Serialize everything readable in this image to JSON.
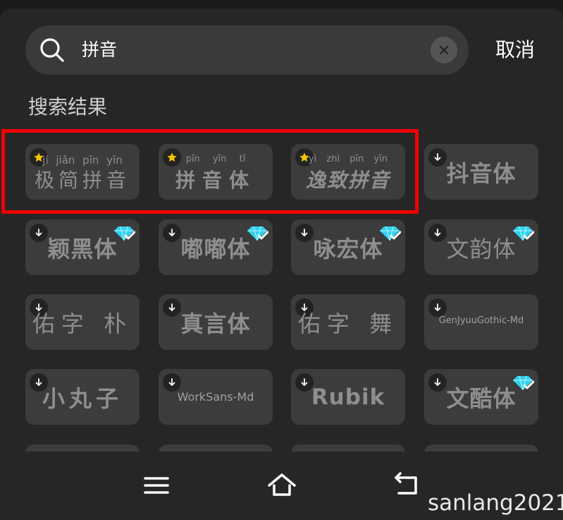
{
  "search": {
    "query": "拼音"
  },
  "header": {
    "cancel_label": "取消"
  },
  "section": {
    "title": "搜索结果"
  },
  "fonts": {
    "jijian": {
      "pinyin": "jí jiǎn pīn yīn",
      "hanzi": "极简拼音"
    },
    "pinyinti": {
      "pinyin": "pīn yīn tǐ",
      "hanzi": "拼音体"
    },
    "yizhi": {
      "pinyin": "yì zhì pīn yīn",
      "hanzi": "逸致拼音"
    },
    "douyin": "抖音体",
    "yinghei": "颖黑体",
    "dudu": "嘟嘟体",
    "yonghong": "咏宏体",
    "wenyun": "文韵体",
    "youzipu": "佑字 朴",
    "zhenyan": "真言体",
    "youziwu": "佑字 舞",
    "genjyuu": "GenJyuuGothic-Md",
    "xiaowanzi": "小丸子",
    "worksans": "WorkSans-Md",
    "rubik": "Rubik",
    "wenku": "文酷体"
  },
  "watermark": "sanlang2021",
  "colors": {
    "highlight": "#f20000",
    "star": "#f5c400",
    "vip": "#2fd3f0"
  }
}
